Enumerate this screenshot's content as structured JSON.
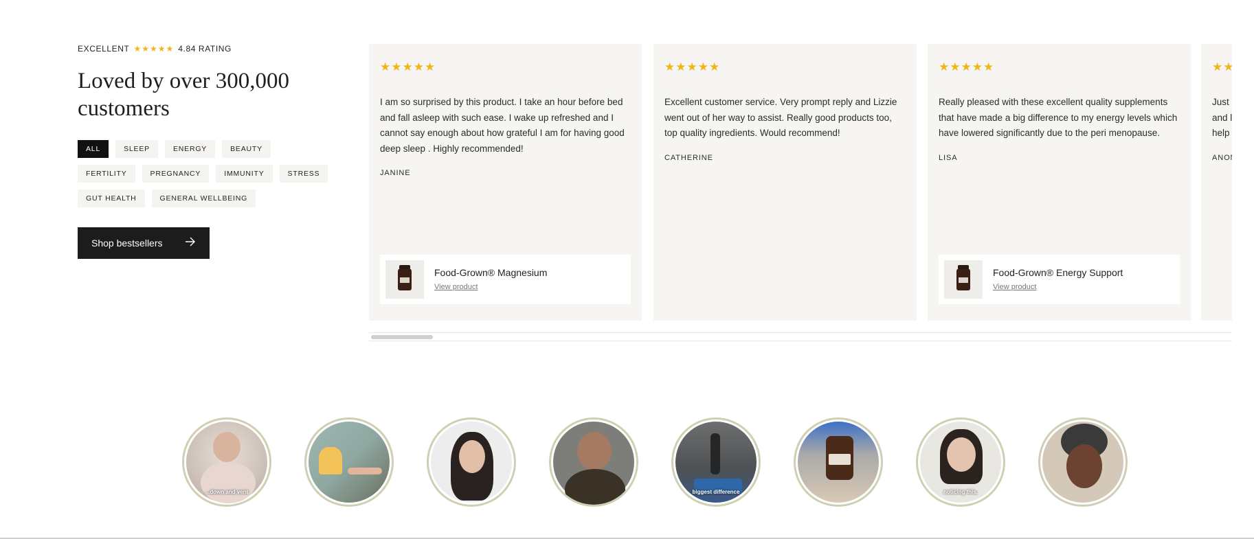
{
  "rating": {
    "label": "EXCELLENT",
    "stars": "★★★★★",
    "score": "4.84 RATING"
  },
  "headline": "Loved by over 300,000 customers",
  "tags": [
    "ALL",
    "SLEEP",
    "ENERGY",
    "BEAUTY",
    "FERTILITY",
    "PREGNANCY",
    "IMMUNITY",
    "STRESS",
    "GUT HEALTH",
    "GENERAL WELLBEING"
  ],
  "shop_button": {
    "label": "Shop bestsellers",
    "icon": "arrow-right-icon"
  },
  "reviews": [
    {
      "stars": "★★★★★",
      "text": "I am so surprised by this product. I take an hour before bed and fall asleep with such ease. I wake up refreshed and I cannot say enough about how grateful I am for having good deep sleep . Highly recommended!",
      "author": "JANINE",
      "product": {
        "name": "Food-Grown® Magnesium",
        "link": "View product"
      }
    },
    {
      "stars": "★★★★★",
      "text": "Excellent customer service. Very prompt reply and Lizzie went out of her way to assist. Really good products too, top quality ingredients. Would recommend!",
      "author": "CATHERINE"
    },
    {
      "stars": "★★★★★",
      "text": "Really pleased with these excellent quality supplements that have made a big difference to my energy levels which have lowered significantly due to the peri menopause.",
      "author": "LISA",
      "product": {
        "name": "Food-Grown® Energy Support",
        "link": "View product"
      }
    },
    {
      "stars": "★★★★★",
      "text": "Just\nand l\nhelp",
      "author": "ANON"
    }
  ],
  "videos": [
    {
      "caption": "...down and vent"
    },
    {
      "caption": ""
    },
    {
      "caption": ""
    },
    {
      "caption": ""
    },
    {
      "caption": "biggest difference"
    },
    {
      "caption": ""
    },
    {
      "caption": "noticing this."
    },
    {
      "caption": ""
    }
  ],
  "colors": {
    "star": "#f1b51c",
    "card_bg": "#f6f5f2",
    "tag_bg": "#f6f4f0",
    "button_bg": "#1c1c1c",
    "video_ring": "#cdd0b2"
  }
}
